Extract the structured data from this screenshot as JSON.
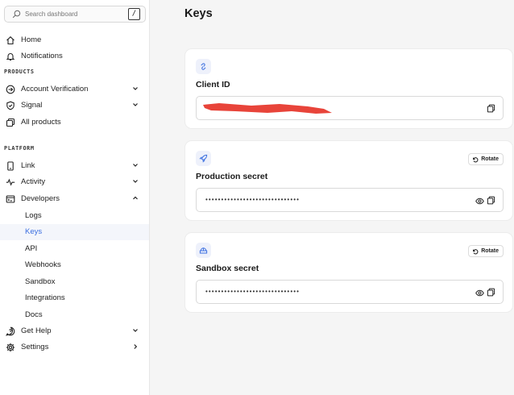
{
  "search": {
    "placeholder": "Search dashboard",
    "shortcut": "/"
  },
  "sidebar": {
    "top_items": [
      {
        "label": "Home",
        "icon": "home-icon"
      },
      {
        "label": "Notifications",
        "icon": "bell-icon"
      }
    ],
    "sections": [
      {
        "heading": "PRODUCTS",
        "items": [
          {
            "label": "Account Verification",
            "icon": "arrow-circle-icon",
            "chevron": "down"
          },
          {
            "label": "Signal",
            "icon": "shield-check-icon",
            "chevron": "down"
          },
          {
            "label": "All products",
            "icon": "copy-icon"
          }
        ]
      },
      {
        "heading": "PLATFORM",
        "items": [
          {
            "label": "Link",
            "icon": "phone-icon",
            "chevron": "down"
          },
          {
            "label": "Activity",
            "icon": "activity-icon",
            "chevron": "down"
          },
          {
            "label": "Developers",
            "icon": "terminal-icon",
            "chevron": "up"
          }
        ]
      }
    ],
    "developers_sub": [
      "Logs",
      "Keys",
      "API",
      "Webhooks",
      "Sandbox",
      "Integrations",
      "Docs"
    ],
    "active_sub": "Keys",
    "bottom_items": [
      {
        "label": "Get Help",
        "icon": "help-icon",
        "chevron": "down"
      },
      {
        "label": "Settings",
        "icon": "gear-icon",
        "chevron": "right"
      }
    ]
  },
  "page": {
    "title": "Keys"
  },
  "cards": [
    {
      "title": "Client ID",
      "icon": "link-icon",
      "value": "",
      "redacted": true
    },
    {
      "title": "Production secret",
      "icon": "rocket-icon",
      "rotate_label": "Rotate",
      "value": "••••••••••••••••••••••••••••••"
    },
    {
      "title": "Sandbox secret",
      "icon": "sandbox-icon",
      "rotate_label": "Rotate",
      "value": "••••••••••••••••••••••••••••••"
    }
  ],
  "colors": {
    "accent": "#3b6fe0",
    "redaction": "#e8443a",
    "badge_bg": "#eef1fb"
  }
}
